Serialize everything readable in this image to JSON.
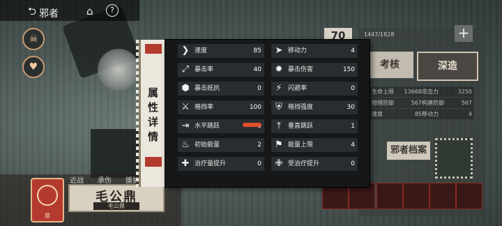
{
  "nav": {
    "back_label": "返",
    "back_suffix": "邪者",
    "home_icon": "home-icon",
    "help_label": "?"
  },
  "side_buttons": [
    {
      "icon": "mask-icon",
      "glyph": "☠"
    },
    {
      "icon": "heart-icon",
      "glyph": "♥"
    }
  ],
  "character": {
    "name": "毛公鼎",
    "sub_name": "毛公鼎",
    "emblem_label": "鼎",
    "tabs": [
      "近战",
      "承伤",
      "援护"
    ]
  },
  "right_panel": {
    "level": "70",
    "exp": "1447/1828",
    "buttons": [
      "考核",
      "深造"
    ],
    "mini_stats": [
      [
        "生命上限",
        "13668",
        "攻击力",
        "3250"
      ],
      [
        "物理防御",
        "567",
        "构建防御",
        "567"
      ],
      [
        "速度",
        "85",
        "移动力",
        "4"
      ]
    ],
    "archive_label": "邪者档案"
  },
  "popup": {
    "title": "属性详情",
    "stats": [
      [
        {
          "icon": "speed-icon",
          "label": "速度",
          "value": "85"
        },
        {
          "icon": "move-icon",
          "label": "移动力",
          "value": "4"
        }
      ],
      [
        {
          "icon": "crit-rate-icon",
          "label": "暴击率",
          "value": "40"
        },
        {
          "icon": "crit-damage-icon",
          "label": "暴击伤害",
          "value": "150"
        }
      ],
      [
        {
          "icon": "crit-resist-icon",
          "label": "暴击抵抗",
          "value": "0"
        },
        {
          "icon": "dodge-icon",
          "label": "闪避率",
          "value": "0"
        }
      ],
      [
        {
          "icon": "block-rate-icon",
          "label": "格挡率",
          "value": "100"
        },
        {
          "icon": "block-strength-icon",
          "label": "格挡强度",
          "value": "30"
        }
      ],
      [
        {
          "icon": "horizontal-jump-icon",
          "label": "水平跳跃",
          "value": "0"
        },
        {
          "icon": "vertical-jump-icon",
          "label": "垂直跳跃",
          "value": "1"
        }
      ],
      [
        {
          "icon": "initial-energy-icon",
          "label": "初始能量",
          "value": "2"
        },
        {
          "icon": "energy-cap-icon",
          "label": "能量上限",
          "value": "4"
        }
      ],
      [
        {
          "icon": "heal-boost-icon",
          "label": "治疗量提升",
          "value": "0"
        },
        {
          "icon": "heal-received-icon",
          "label": "受治疗提升",
          "value": "0"
        }
      ]
    ]
  },
  "colors": {
    "accent_red": "#e0502c",
    "popup_bg": "#151718",
    "cell_bg": "#2a2d2f"
  }
}
